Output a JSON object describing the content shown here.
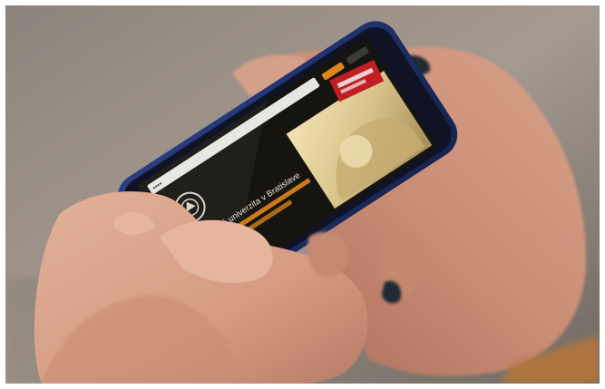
{
  "photo": {
    "subject": "hands holding a smartphone in landscape orientation displaying a website",
    "colors": {
      "background": "#9a8f86",
      "skin": "#d9a58c",
      "skin_shadow": "#b97f6a",
      "nail_polish": "#1f2a33",
      "phone_body": "#1d2f6b",
      "screen_dark": "#16140f",
      "accent_orange": "#e0851c",
      "brand_red": "#c21f24"
    }
  },
  "phone_screen": {
    "url_bar_text": "••••",
    "nav_item_1": "",
    "nav_item_2": "",
    "site_name": "...onomická univerzita v Bratislave",
    "headline": "",
    "banner_label": ""
  }
}
